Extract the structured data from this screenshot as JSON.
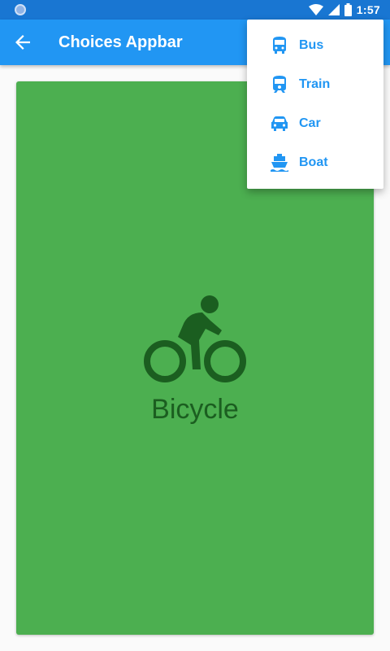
{
  "status_bar": {
    "time": "1:57"
  },
  "app_bar": {
    "title": "Choices Appbar"
  },
  "card": {
    "label": "Bicycle",
    "icon": "bicycle-icon",
    "background": "#4caf50",
    "foreground": "#1b5e20"
  },
  "menu": {
    "items": [
      {
        "label": "Bus",
        "icon": "bus-icon"
      },
      {
        "label": "Train",
        "icon": "train-icon"
      },
      {
        "label": "Car",
        "icon": "car-icon"
      },
      {
        "label": "Boat",
        "icon": "boat-icon"
      }
    ]
  },
  "colors": {
    "primary": "#2196f3",
    "primary_dark": "#1976d2"
  }
}
